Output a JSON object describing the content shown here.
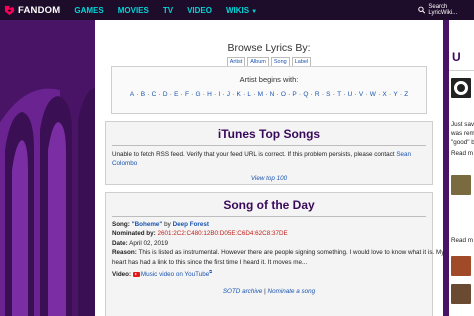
{
  "topbar": {
    "brand": "FANDOM",
    "nav": [
      "GAMES",
      "MOVIES",
      "TV",
      "VIDEO",
      "WIKIS"
    ],
    "search_placeholder": "Search LyricWiki..."
  },
  "browse": {
    "title": "Browse Lyrics By:",
    "tabs": [
      "Artist",
      "Album",
      "Song",
      "Label"
    ],
    "caption": "Artist begins with:",
    "letters": [
      "A",
      "B",
      "C",
      "D",
      "E",
      "F",
      "G",
      "H",
      "I",
      "J",
      "K",
      "L",
      "M",
      "N",
      "O",
      "P",
      "Q",
      "R",
      "S",
      "T",
      "U",
      "V",
      "W",
      "X",
      "Y",
      "Z"
    ]
  },
  "itunes": {
    "title": "iTunes Top Songs",
    "message": "Unable to fetch RSS feed. Verify that your feed URL is correct. If this problem persists, please contact",
    "contact_link": "Sean Colombo",
    "view_link": "View top 100"
  },
  "sotd": {
    "title": "Song of the Day",
    "song_label": "Song:",
    "song_title": "\"Boheme\"",
    "by": "by",
    "artist": "Deep Forest",
    "nominated_label": "Nominated by:",
    "nominator": "2601:2C2:C480:12B0:D05E:C6D4:62C8:37DE",
    "date_label": "Date:",
    "date": "April 02, 2019",
    "reason_label": "Reason:",
    "reason_line1": "This is listed as instrumental. However there are people signing something. I would love to know what it is. My",
    "reason_line2": "heart has had a link to this since the first time I heard it. It moves me...",
    "video_label": "Video:",
    "video_link": "Music video on YouTube",
    "archive_link": "SOTD archive",
    "separator": "|",
    "nominate_link": "Nominate a song"
  },
  "rail": {
    "heading": "U",
    "snippet1": "Just sav",
    "snippet2": "was rem",
    "snippet3": "\"good\" b",
    "readmore1": "Read m",
    "readmore2": "Read m"
  },
  "colors": {
    "topbar": "#1e0c2b",
    "nav_accent": "#00d6d6",
    "background": "#5c1e78",
    "heading": "#3a0a5a",
    "link": "#1a54b0",
    "nominator": "#c0211b"
  }
}
